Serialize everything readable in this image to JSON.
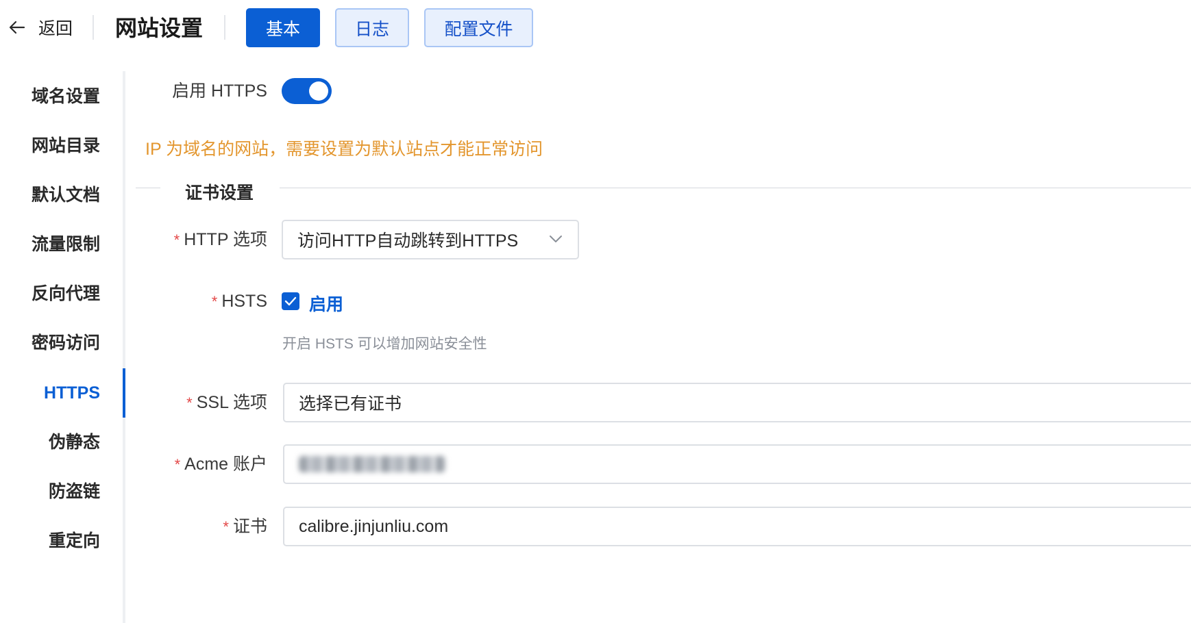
{
  "header": {
    "back_label": "返回",
    "title": "网站设置",
    "tabs": [
      {
        "label": "基本",
        "active": true
      },
      {
        "label": "日志",
        "active": false
      },
      {
        "label": "配置文件",
        "active": false
      }
    ]
  },
  "sidebar": {
    "items": [
      {
        "label": "域名设置"
      },
      {
        "label": "网站目录"
      },
      {
        "label": "默认文档"
      },
      {
        "label": "流量限制"
      },
      {
        "label": "反向代理"
      },
      {
        "label": "密码访问"
      },
      {
        "label": "HTTPS",
        "active": true
      },
      {
        "label": "伪静态"
      },
      {
        "label": "防盗链"
      },
      {
        "label": "重定向"
      }
    ]
  },
  "form": {
    "https_label": "启用 HTTPS",
    "https_enabled": true,
    "warning": "IP 为域名的网站，需要设置为默认站点才能正常访问",
    "section_title": "证书设置",
    "required_mark": "*",
    "http_option_label": "HTTP 选项",
    "http_option_value": "访问HTTP自动跳转到HTTPS",
    "hsts_label": "HSTS",
    "hsts_checked": true,
    "hsts_check_label": "启用",
    "hsts_hint": "开启 HSTS 可以增加网站安全性",
    "ssl_option_label": "SSL 选项",
    "ssl_option_value": "选择已有证书",
    "acme_label": "Acme 账户",
    "cert_label": "证书",
    "cert_value": "calibre.jinjunliu.com"
  },
  "colors": {
    "accent": "#0b5fd4",
    "warning": "#e3962e",
    "required": "#e34848"
  },
  "icons": {
    "back": "arrow-left-icon",
    "select": "chevron-down-icon",
    "check": "checkmark-icon"
  }
}
